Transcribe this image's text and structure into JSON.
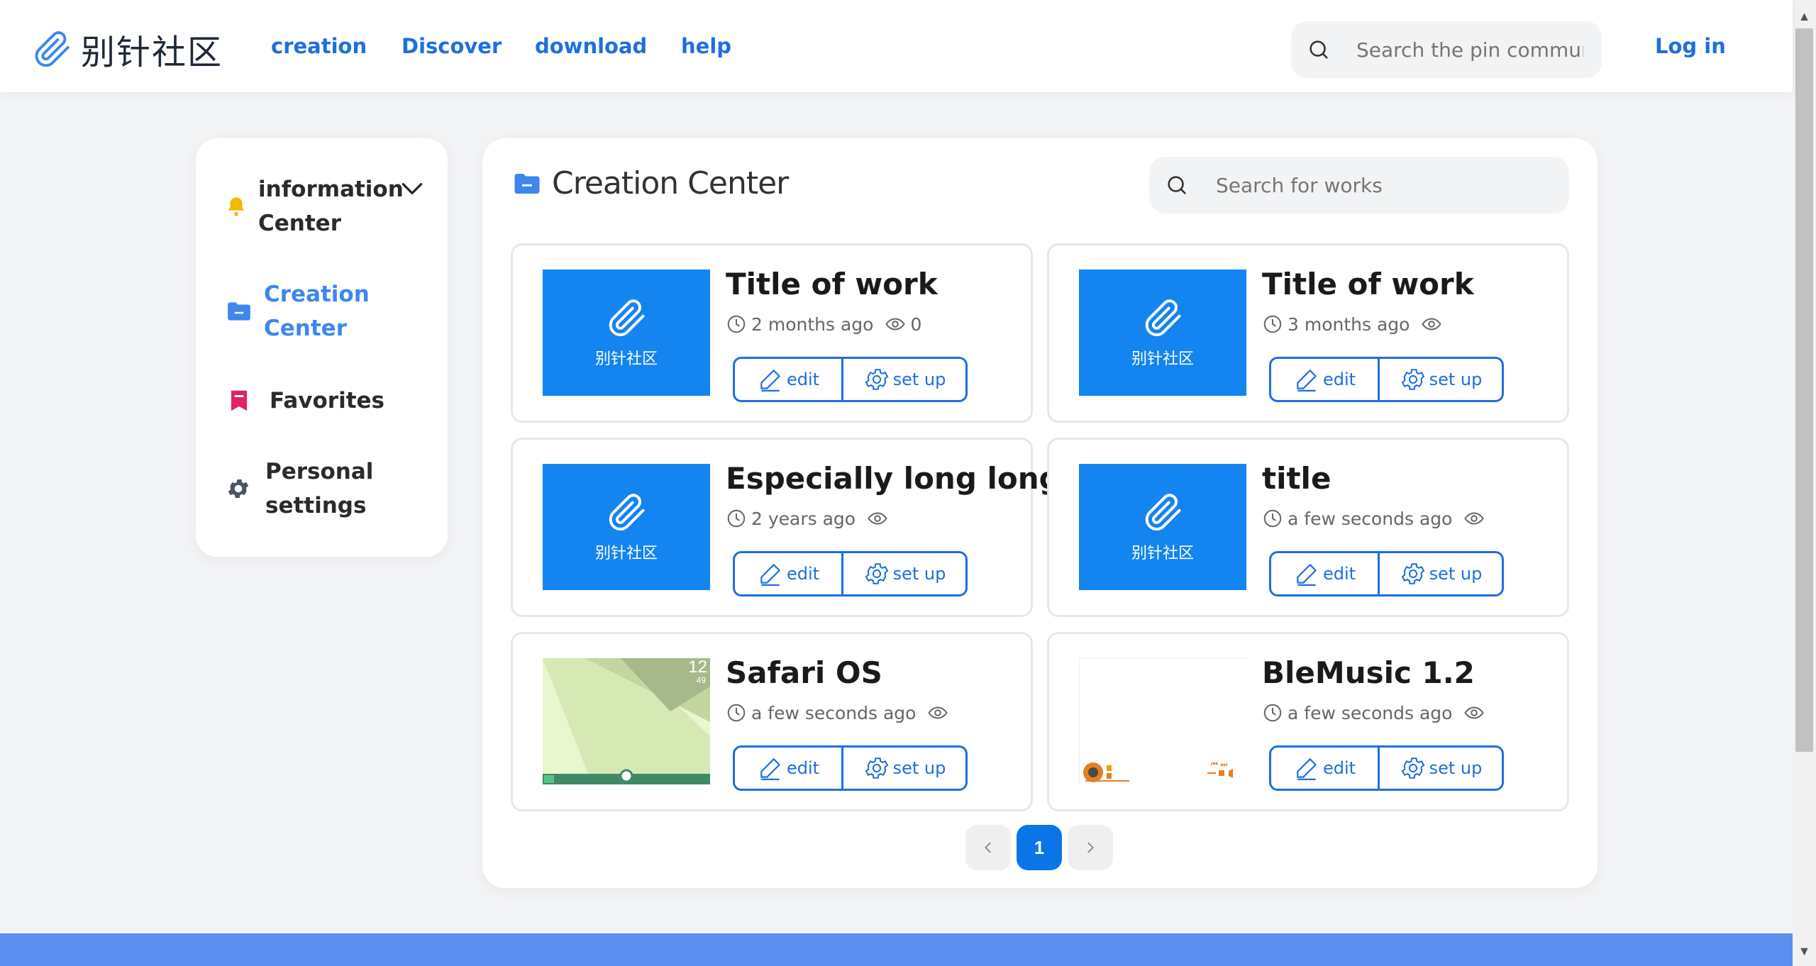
{
  "header": {
    "logo_text": "别针社区",
    "nav": [
      "creation",
      "Discover",
      "download",
      "help"
    ],
    "search_placeholder": "Search the pin commun",
    "login": "Log in"
  },
  "sidebar": {
    "items": [
      {
        "label": "information Center",
        "icon": "bell-icon",
        "color": "#f5b800"
      },
      {
        "label": "Creation Center",
        "icon": "folder-icon",
        "color": "#3c87f0",
        "active": true
      },
      {
        "label": "Favorites",
        "icon": "bookmark-icon",
        "color": "#e0245e"
      },
      {
        "label": "Personal settings",
        "icon": "gear-icon",
        "color": "#4b5563"
      }
    ]
  },
  "main": {
    "title": "Creation Center",
    "search_placeholder": "Search for works",
    "works": [
      {
        "title": "Title of work",
        "time": "2 months ago",
        "views": "0",
        "thumb_text": "别针社区",
        "thumb": "default"
      },
      {
        "title": "Title of work",
        "time": "3 months ago",
        "views": "",
        "thumb_text": "别针社区",
        "thumb": "default"
      },
      {
        "title": "Especially long long",
        "time": "2 years ago",
        "views": "",
        "thumb_text": "别针社区",
        "thumb": "default"
      },
      {
        "title": "title",
        "time": "a few seconds ago",
        "views": "",
        "thumb_text": "别针社区",
        "thumb": "default"
      },
      {
        "title": "Safari OS",
        "time": "a few seconds ago",
        "views": "",
        "thumb": "safari-os-screenshot",
        "thumb_clock_hour": "12",
        "thumb_clock_min": "49"
      },
      {
        "title": "BleMusic 1.2",
        "time": "a few seconds ago",
        "views": "",
        "thumb": "blemusic-screenshot"
      }
    ],
    "edit_label": "edit",
    "setup_label": "set up",
    "pagination": {
      "current": "1"
    }
  },
  "colors": {
    "accent": "#1d6fe0",
    "thumb_blue": "#1484f0",
    "footer": "#5b8ff0"
  }
}
